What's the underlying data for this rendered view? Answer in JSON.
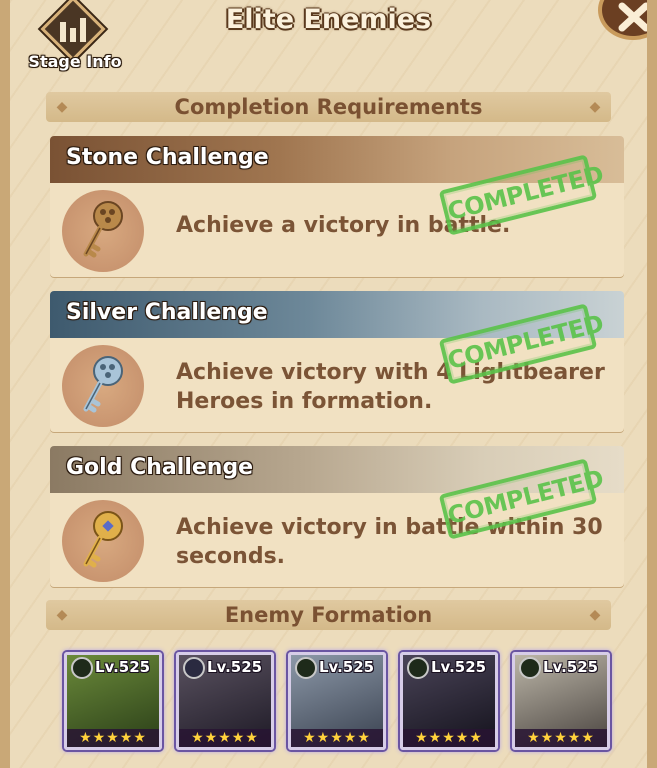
{
  "header": {
    "title": "Elite Enemies",
    "stage_info_label": "Stage Info"
  },
  "sections": {
    "completion": "Completion Requirements",
    "formation": "Enemy Formation"
  },
  "challenges": [
    {
      "name": "Stone Challenge",
      "requirement": "Achieve a victory in battle.",
      "status": "COMPLETED",
      "key_color": "#b9894a"
    },
    {
      "name": "Silver Challenge",
      "requirement": "Achieve victory with 4 Lightbearer Heroes in formation.",
      "status": "COMPLETED",
      "key_color": "#a9c4d8"
    },
    {
      "name": "Gold Challenge",
      "requirement": "Achieve victory in battle within 30 seconds.",
      "status": "COMPLETED",
      "key_color": "#e0b04a"
    }
  ],
  "enemies": [
    {
      "level": "Lv.525",
      "stars": "★★★★★",
      "faction": "wilder",
      "portrait_color": "#4a6a2a"
    },
    {
      "level": "Lv.525",
      "stars": "★★★★★",
      "faction": "celestial",
      "portrait_color": "#3a3440"
    },
    {
      "level": "Lv.525",
      "stars": "★★★★★",
      "faction": "wilder",
      "portrait_color": "#5d6a7a"
    },
    {
      "level": "Lv.525",
      "stars": "★★★★★",
      "faction": "wilder",
      "portrait_color": "#2c2838"
    },
    {
      "level": "Lv.525",
      "stars": "★★★★★",
      "faction": "wilder",
      "portrait_color": "#7a7468"
    }
  ],
  "colors": {
    "completed_stamp": "#5ac34a",
    "panel_bg": "#ecdcbc",
    "text_brown": "#7b5436"
  }
}
